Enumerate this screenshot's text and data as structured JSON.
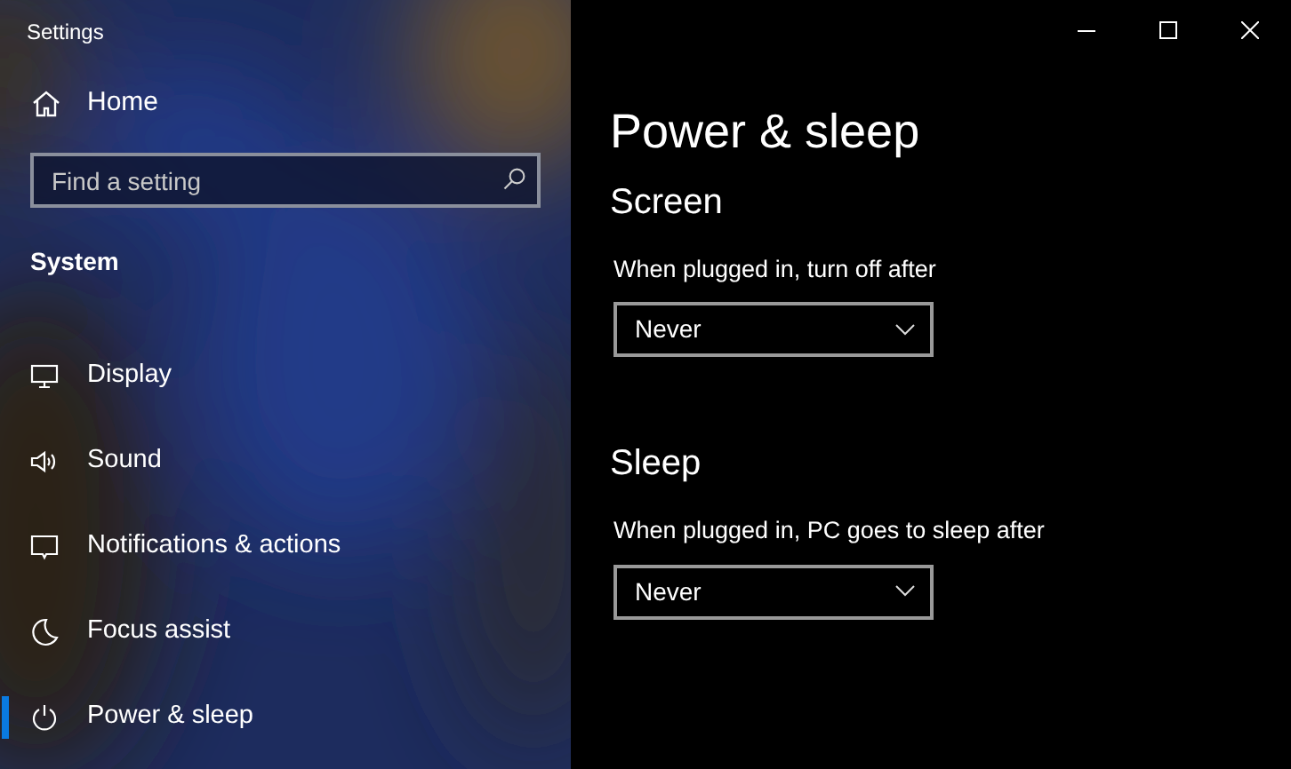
{
  "window": {
    "title": "Settings"
  },
  "sidebar": {
    "home": "Home",
    "search": {
      "placeholder": "Find a setting"
    },
    "group": "System",
    "items": [
      {
        "label": "Display",
        "selected": false
      },
      {
        "label": "Sound",
        "selected": false
      },
      {
        "label": "Notifications & actions",
        "selected": false
      },
      {
        "label": "Focus assist",
        "selected": false
      },
      {
        "label": "Power & sleep",
        "selected": true
      }
    ]
  },
  "page": {
    "title": "Power & sleep",
    "sections": [
      {
        "title": "Screen",
        "setting": {
          "label": "When plugged in, turn off after",
          "value": "Never"
        }
      },
      {
        "title": "Sleep",
        "setting": {
          "label": "When plugged in, PC goes to sleep after",
          "value": "Never"
        }
      }
    ]
  }
}
